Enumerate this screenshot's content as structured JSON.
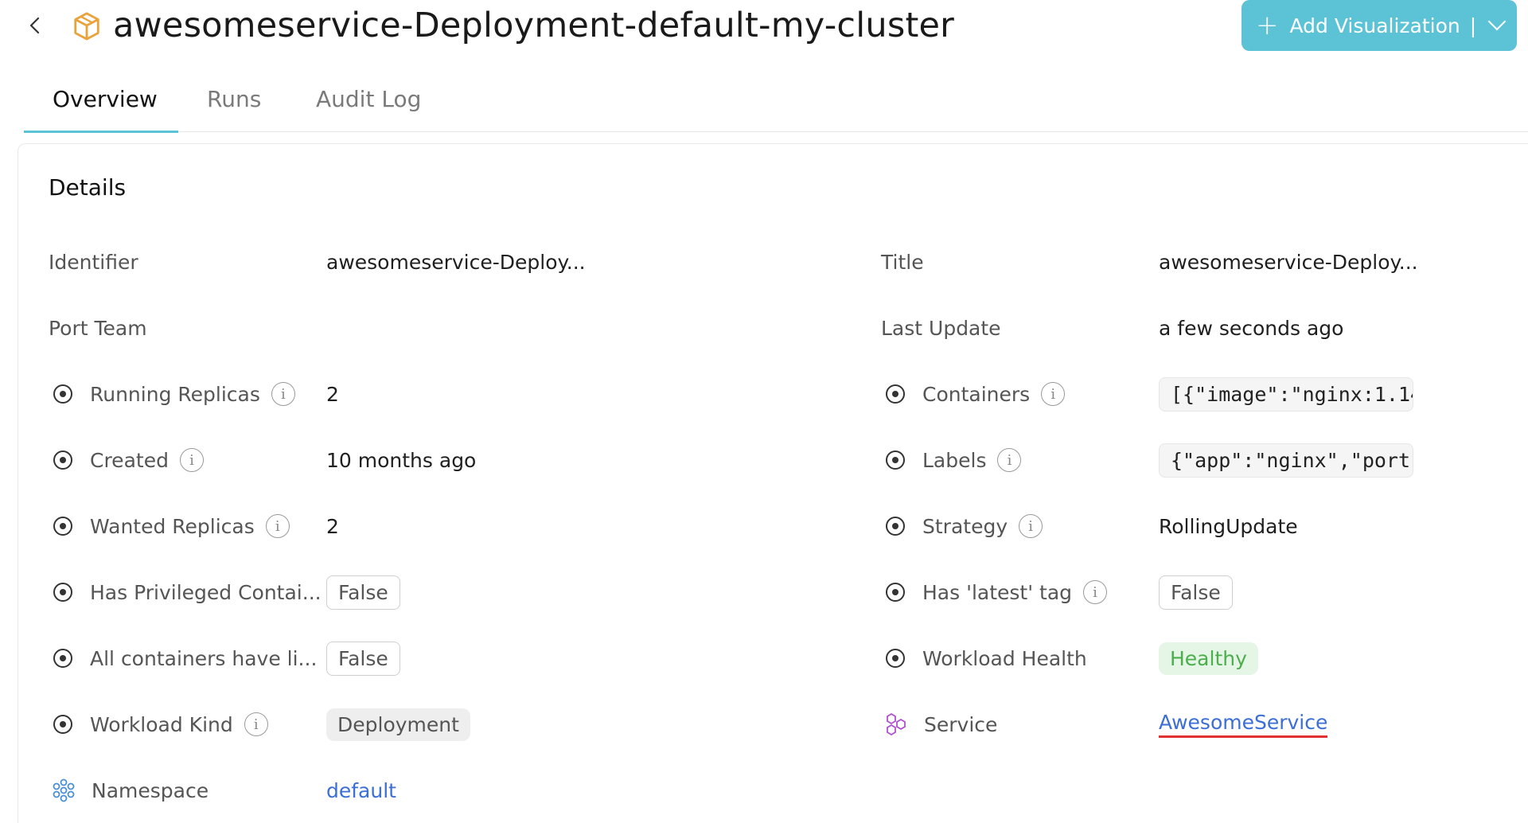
{
  "header": {
    "title": "awesomeservice-Deployment-default-my-cluster",
    "add_button_label": "Add Visualization",
    "add_button_sep": "|"
  },
  "tabs": [
    {
      "label": "Overview",
      "active": true
    },
    {
      "label": "Runs",
      "active": false
    },
    {
      "label": "Audit Log",
      "active": false
    }
  ],
  "details": {
    "title": "Details",
    "left": [
      {
        "label": "Identifier",
        "value": "awesomeservice-Deploy..."
      },
      {
        "label": "Port Team",
        "value": ""
      },
      {
        "label": "Running Replicas",
        "value": "2",
        "icon": "property-icon",
        "info": true
      },
      {
        "label": "Created",
        "value": "10 months ago",
        "icon": "property-icon",
        "info": true
      },
      {
        "label": "Wanted Replicas",
        "value": "2",
        "icon": "property-icon",
        "info": true
      },
      {
        "label": "Has Privileged Contai...",
        "value": "False",
        "icon": "property-icon",
        "style": "outline"
      },
      {
        "label": "All containers have li...",
        "value": "False",
        "icon": "property-icon",
        "style": "outline"
      },
      {
        "label": "Workload Kind",
        "value": "Deployment",
        "icon": "property-icon",
        "info": true,
        "style": "grey"
      },
      {
        "label": "Namespace",
        "value": "default",
        "icon": "namespace-icon",
        "style": "link"
      }
    ],
    "right": [
      {
        "label": "Title",
        "value": "awesomeservice-Deploy..."
      },
      {
        "label": "Last Update",
        "value": "a few seconds ago"
      },
      {
        "label": "Containers",
        "value": "[{\"image\":\"nginx:1.14",
        "icon": "property-icon",
        "info": true,
        "style": "code"
      },
      {
        "label": "Labels",
        "value": "{\"app\":\"nginx\",\"port\":",
        "icon": "property-icon",
        "info": true,
        "style": "code"
      },
      {
        "label": "Strategy",
        "value": "RollingUpdate",
        "icon": "property-icon",
        "info": true
      },
      {
        "label": "Has 'latest' tag",
        "value": "False",
        "icon": "property-icon",
        "info": true,
        "style": "outline"
      },
      {
        "label": "Workload Health",
        "value": "Healthy",
        "icon": "property-icon",
        "style": "green"
      },
      {
        "label": "Service",
        "value": "AwesomeService",
        "icon": "service-icon",
        "style": "link-underlined"
      }
    ]
  },
  "colors": {
    "accent": "#5cc3d6",
    "link": "#3b6ed6",
    "healthy": "#4cae4c",
    "entity_icon": "#e8a33d"
  }
}
